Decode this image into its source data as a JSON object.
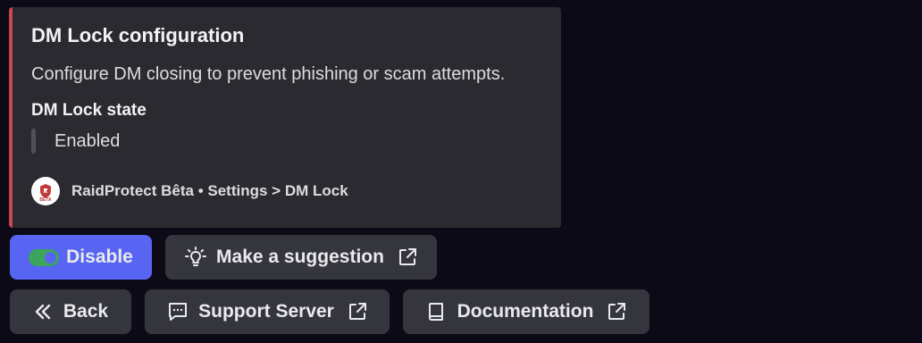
{
  "embed": {
    "title": "DM Lock configuration",
    "description": "Configure DM closing to prevent phishing or scam attempts.",
    "field_name": "DM Lock state",
    "field_value": "Enabled",
    "footer_text": "RaidProtect Bêta • Settings > DM Lock",
    "footer_avatar_label": "BÊTA",
    "accent_color": "#c9474f"
  },
  "buttons": {
    "disable": {
      "label": "Disable",
      "icon": "toggle-on-icon"
    },
    "suggestion": {
      "label": "Make a suggestion",
      "icon": "lightbulb-icon",
      "trailing_icon": "external-link-icon"
    },
    "back": {
      "label": "Back",
      "icon": "double-chevron-left-icon"
    },
    "support": {
      "label": "Support Server",
      "icon": "chat-bubble-icon",
      "trailing_icon": "external-link-icon"
    },
    "documentation": {
      "label": "Documentation",
      "icon": "book-icon",
      "trailing_icon": "external-link-icon"
    }
  }
}
